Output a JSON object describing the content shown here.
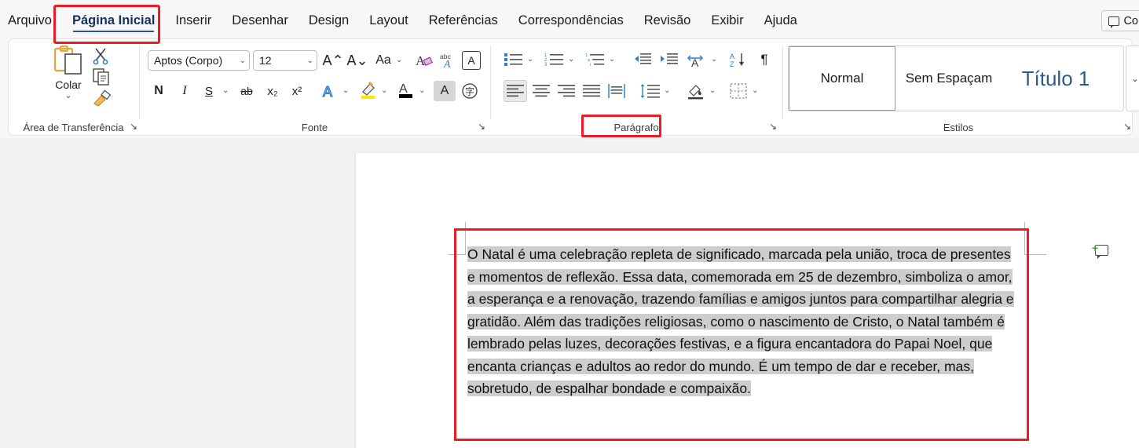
{
  "app": {
    "tabs": [
      {
        "label": "Arquivo",
        "active": false
      },
      {
        "label": "Página Inicial",
        "active": true
      },
      {
        "label": "Inserir",
        "active": false
      },
      {
        "label": "Desenhar",
        "active": false
      },
      {
        "label": "Design",
        "active": false
      },
      {
        "label": "Layout",
        "active": false
      },
      {
        "label": "Referências",
        "active": false
      },
      {
        "label": "Correspondências",
        "active": false
      },
      {
        "label": "Revisão",
        "active": false
      },
      {
        "label": "Exibir",
        "active": false
      },
      {
        "label": "Ajuda",
        "active": false
      }
    ],
    "comments_button": "Co"
  },
  "ribbon": {
    "clipboard": {
      "label": "Área de Transferência",
      "paste_label": "Colar",
      "paste_chevron": "⌄",
      "cut_icon": "scissors-icon",
      "copy_icon": "copy-icon",
      "format_painter_icon": "format-painter-icon",
      "launcher": "↘"
    },
    "font": {
      "label": "Fonte",
      "font_family_value": "Aptos (Corpo)",
      "font_size_value": "12",
      "grow_font": "A⌃",
      "shrink_font": "A⌄",
      "change_case": "Aa",
      "clear_formatting": "A",
      "phonetic_guide": "abc",
      "character_border": "A",
      "bold": "N",
      "italic": "I",
      "underline": "S",
      "strikethrough": "ab",
      "subscript": "x₂",
      "superscript": "x²",
      "text_effects": "A",
      "highlight_color": "#ffe600",
      "font_color": "#000000",
      "text_shading": "A",
      "character_shading": "字",
      "launcher": "↘"
    },
    "paragraph": {
      "label": "Parágrafo",
      "bullets": "bullets-icon",
      "numbering": "numbering-icon",
      "multilevel": "multilevel-list-icon",
      "decrease_indent": "decrease-indent-icon",
      "increase_indent": "increase-indent-icon",
      "text_direction": "text-direction-icon",
      "sort": "sort-az-icon",
      "show_marks": "¶",
      "align_left": "align-left-icon",
      "align_center": "align-center-icon",
      "align_right": "align-right-icon",
      "justify": "justify-icon",
      "distributed": "distributed-icon",
      "line_spacing": "line-spacing-icon",
      "shading": "shading-icon",
      "borders": "borders-icon",
      "launcher": "↘"
    },
    "styles": {
      "label": "Estilos",
      "items": [
        {
          "name": "Normal",
          "active": true
        },
        {
          "name": "Sem Espaçam",
          "active": false
        },
        {
          "name": "Título 1",
          "active": false,
          "heading": true
        }
      ],
      "more": "⌄",
      "launcher": "↘"
    }
  },
  "document": {
    "paragraph_text": "O Natal é uma celebração repleta de significado, marcada pela união, troca de presentes e momentos de reflexão. Essa data, comemorada em 25 de dezembro, simboliza o amor, a esperança e a renovação, trazendo famílias e amigos juntos para compartilhar alegria e gratidão. Além das tradições religiosas, como o nascimento de Cristo, o Natal também é lembrado pelas luzes, decorações festivas, e a figura encantadora do Papai Noel, que encanta crianças e adultos ao redor do mundo. É um tempo de dar e receber, mas, sobretudo, de espalhar bondade e compaixão.",
    "new_comment_icon": "new-comment-icon",
    "selection_color": "#cdcdcd"
  },
  "annotations": {
    "color": "#ec1c24",
    "boxes": [
      {
        "name": "pagina-inicial-tab-highlight"
      },
      {
        "name": "paragrafo-group-highlight"
      },
      {
        "name": "selected-paragraph-highlight"
      }
    ]
  }
}
